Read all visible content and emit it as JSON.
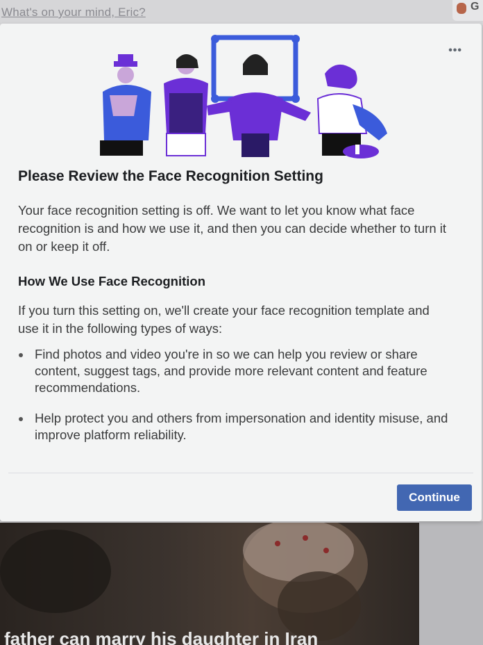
{
  "background": {
    "composer_prompt": "What's on your mind, Eric?",
    "feed_caption": "father can marry his daughter in Iran"
  },
  "modal": {
    "more_label": "•••",
    "title": "Please Review the Face Recognition Setting",
    "intro": "Your face recognition setting is off. We want to let you know what face recognition is and how we use it, and then you can decide whether to turn it on or keep it off.",
    "subheading": "How We Use Face Recognition",
    "uses_intro": "If you turn this setting on, we'll create your face recognition template and use it in the following types of ways:",
    "bullets": [
      "Find photos and video you're in so we can help you review or share content, suggest tags, and provide more relevant content and feature recommendations.",
      "Help protect you and others from impersonation and identity misuse, and improve platform reliability."
    ],
    "continue_label": "Continue"
  },
  "colors": {
    "accent": "#4267b2",
    "illustration_purple": "#6b2fd6",
    "illustration_blue": "#3b5bdb"
  }
}
